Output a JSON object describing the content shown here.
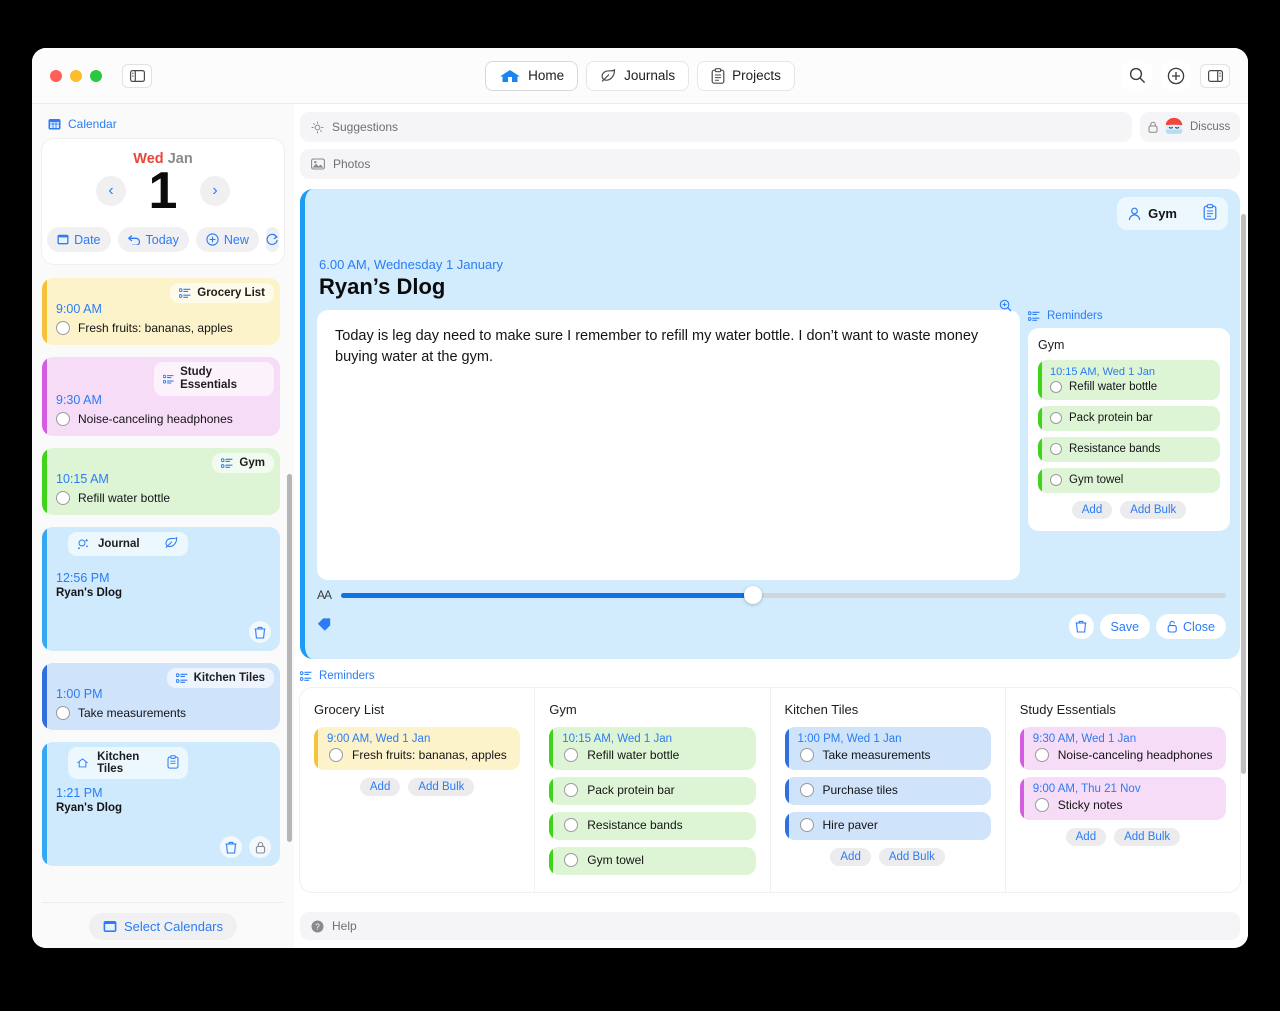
{
  "window": {
    "nav": [
      {
        "label": "Home",
        "icon": "home-icon",
        "active": true
      },
      {
        "label": "Journals",
        "icon": "leaf-icon",
        "active": false
      },
      {
        "label": "Projects",
        "icon": "clipboard-icon",
        "active": false
      }
    ],
    "right_icons": [
      "search-icon",
      "add-circle-icon",
      "right-panel-icon"
    ],
    "left_icon": "left-panel-icon"
  },
  "sidebar": {
    "header": {
      "label": "Calendar",
      "icon": "calendar-icon"
    },
    "calendar": {
      "weekday": "Wed",
      "month": "Jan",
      "day": "1",
      "prev": "‹",
      "next": "›",
      "actions": [
        {
          "label": "Date",
          "icon": "calendar-icon"
        },
        {
          "label": "Today",
          "icon": "undo-icon"
        },
        {
          "label": "New",
          "icon": "plus-circle-icon"
        },
        {
          "label": "",
          "icon": "refresh-icon"
        }
      ]
    },
    "events": [
      {
        "tag": "Grocery List",
        "tag_icon": "list-icon",
        "time": "9:00 AM",
        "task": "Fresh fruits: bananas, apples",
        "bg": "#fdf3cb",
        "stripe": "#f5c33b",
        "type": "task"
      },
      {
        "tag": "Study Essentials",
        "tag_icon": "list-icon",
        "time": "9:30 AM",
        "task": "Noise-canceling headphones",
        "bg": "#f6dcf7",
        "stripe": "#d45ce0",
        "type": "task"
      },
      {
        "tag": "Gym",
        "tag_icon": "list-icon",
        "time": "10:15 AM",
        "task": "Refill water bottle",
        "bg": "#ddf5d4",
        "stripe": "#3fd41a",
        "type": "task"
      },
      {
        "tag": "Journal",
        "tag_icon": "sparkle-icon",
        "time": "12:56 PM",
        "title": "Ryan's Dlog",
        "corner_icon": "leaf-icon",
        "bg": "#cfeafc",
        "stripe": "#35a8f4",
        "type": "journal",
        "footer_icons": [
          "trash-icon"
        ]
      },
      {
        "tag": "Kitchen Tiles",
        "tag_icon": "list-icon",
        "time": "1:00 PM",
        "task": "Take measurements",
        "bg": "#cfe3fa",
        "stripe": "#2f6fe0",
        "type": "task"
      },
      {
        "tag": "Kitchen Tiles",
        "tag_icon": "home-outline-icon",
        "time": "1:21 PM",
        "title": "Ryan's Dlog",
        "corner_icon": "clipboard-icon",
        "bg": "#cfeafc",
        "stripe": "#35a8f4",
        "type": "journal",
        "footer_icons": [
          "trash-icon",
          "lock-icon"
        ]
      }
    ],
    "footer": {
      "label": "Select Calendars",
      "icon": "calendar-icon"
    }
  },
  "main": {
    "suggestions": {
      "label": "Suggestions",
      "icon": "sparkle-icon"
    },
    "discuss": {
      "label": "Discuss",
      "icon": "lock-icon",
      "avatar": "robot-avatar"
    },
    "photos": {
      "label": "Photos",
      "icon": "photo-icon"
    },
    "editor": {
      "tag": "Gym",
      "tag_icon": "person-icon",
      "tag_action_icon": "clipboard-icon",
      "date": "6.00 AM, Wednesday 1 January",
      "title": "Ryan’s Dlog",
      "text": "Today is leg day need to make sure I remember to refill my water bottle. I don’t want to waste money buying water at the gym.",
      "zoom_icon": "zoom-in-icon",
      "font_label": "AA",
      "slider_value": 46.5,
      "tag_icon_bottom": "tag-icon",
      "buttons": [
        {
          "label": "",
          "icon": "trash-icon"
        },
        {
          "label": "Save",
          "icon": ""
        },
        {
          "label": "Close",
          "icon": "unlock-icon"
        }
      ],
      "reminders": {
        "label": "Reminders",
        "icon": "list-icon",
        "list_title": "Gym",
        "items": [
          {
            "time": "10:15 AM, Wed 1 Jan",
            "text": "Refill water bottle"
          },
          {
            "time": "",
            "text": "Pack protein bar"
          },
          {
            "time": "",
            "text": "Resistance bands"
          },
          {
            "time": "",
            "text": "Gym towel"
          }
        ],
        "bg": "#ddf5d4",
        "stripe": "#3fd41a",
        "add": "Add",
        "add_bulk": "Add Bulk"
      }
    },
    "reminders_section": {
      "label": "Reminders",
      "icon": "list-icon",
      "add": "Add",
      "add_bulk": "Add Bulk",
      "columns": [
        {
          "title": "Grocery List",
          "bg": "#fdf3cb",
          "stripe": "#f5c33b",
          "items": [
            {
              "time": "9:00 AM, Wed 1 Jan",
              "text": "Fresh fruits: bananas, apples"
            }
          ]
        },
        {
          "title": "Gym",
          "bg": "#ddf5d4",
          "stripe": "#3fd41a",
          "items": [
            {
              "time": "10:15 AM, Wed 1 Jan",
              "text": "Refill water bottle"
            },
            {
              "time": "",
              "text": "Pack protein bar"
            },
            {
              "time": "",
              "text": "Resistance bands"
            },
            {
              "time": "",
              "text": "Gym towel"
            }
          ]
        },
        {
          "title": "Kitchen Tiles",
          "bg": "#cfe3fa",
          "stripe": "#2f6fe0",
          "items": [
            {
              "time": "1:00 PM, Wed 1 Jan",
              "text": "Take measurements"
            },
            {
              "time": "",
              "text": "Purchase tiles"
            },
            {
              "time": "",
              "text": "Hire paver"
            }
          ]
        },
        {
          "title": "Study Essentials",
          "bg": "#f6dcf7",
          "stripe": "#d45ce0",
          "items": [
            {
              "time": "9:30 AM, Wed 1 Jan",
              "text": "Noise-canceling headphones"
            },
            {
              "time": "9:00 AM, Thu 21 Nov",
              "text": "Sticky notes"
            }
          ]
        }
      ]
    },
    "help": {
      "label": "Help",
      "icon": "help-icon"
    }
  },
  "colors": {
    "accent": "#2b7cf6",
    "editor_bg": "#d2ecfd",
    "editor_stripe": "#1e9bf5"
  }
}
